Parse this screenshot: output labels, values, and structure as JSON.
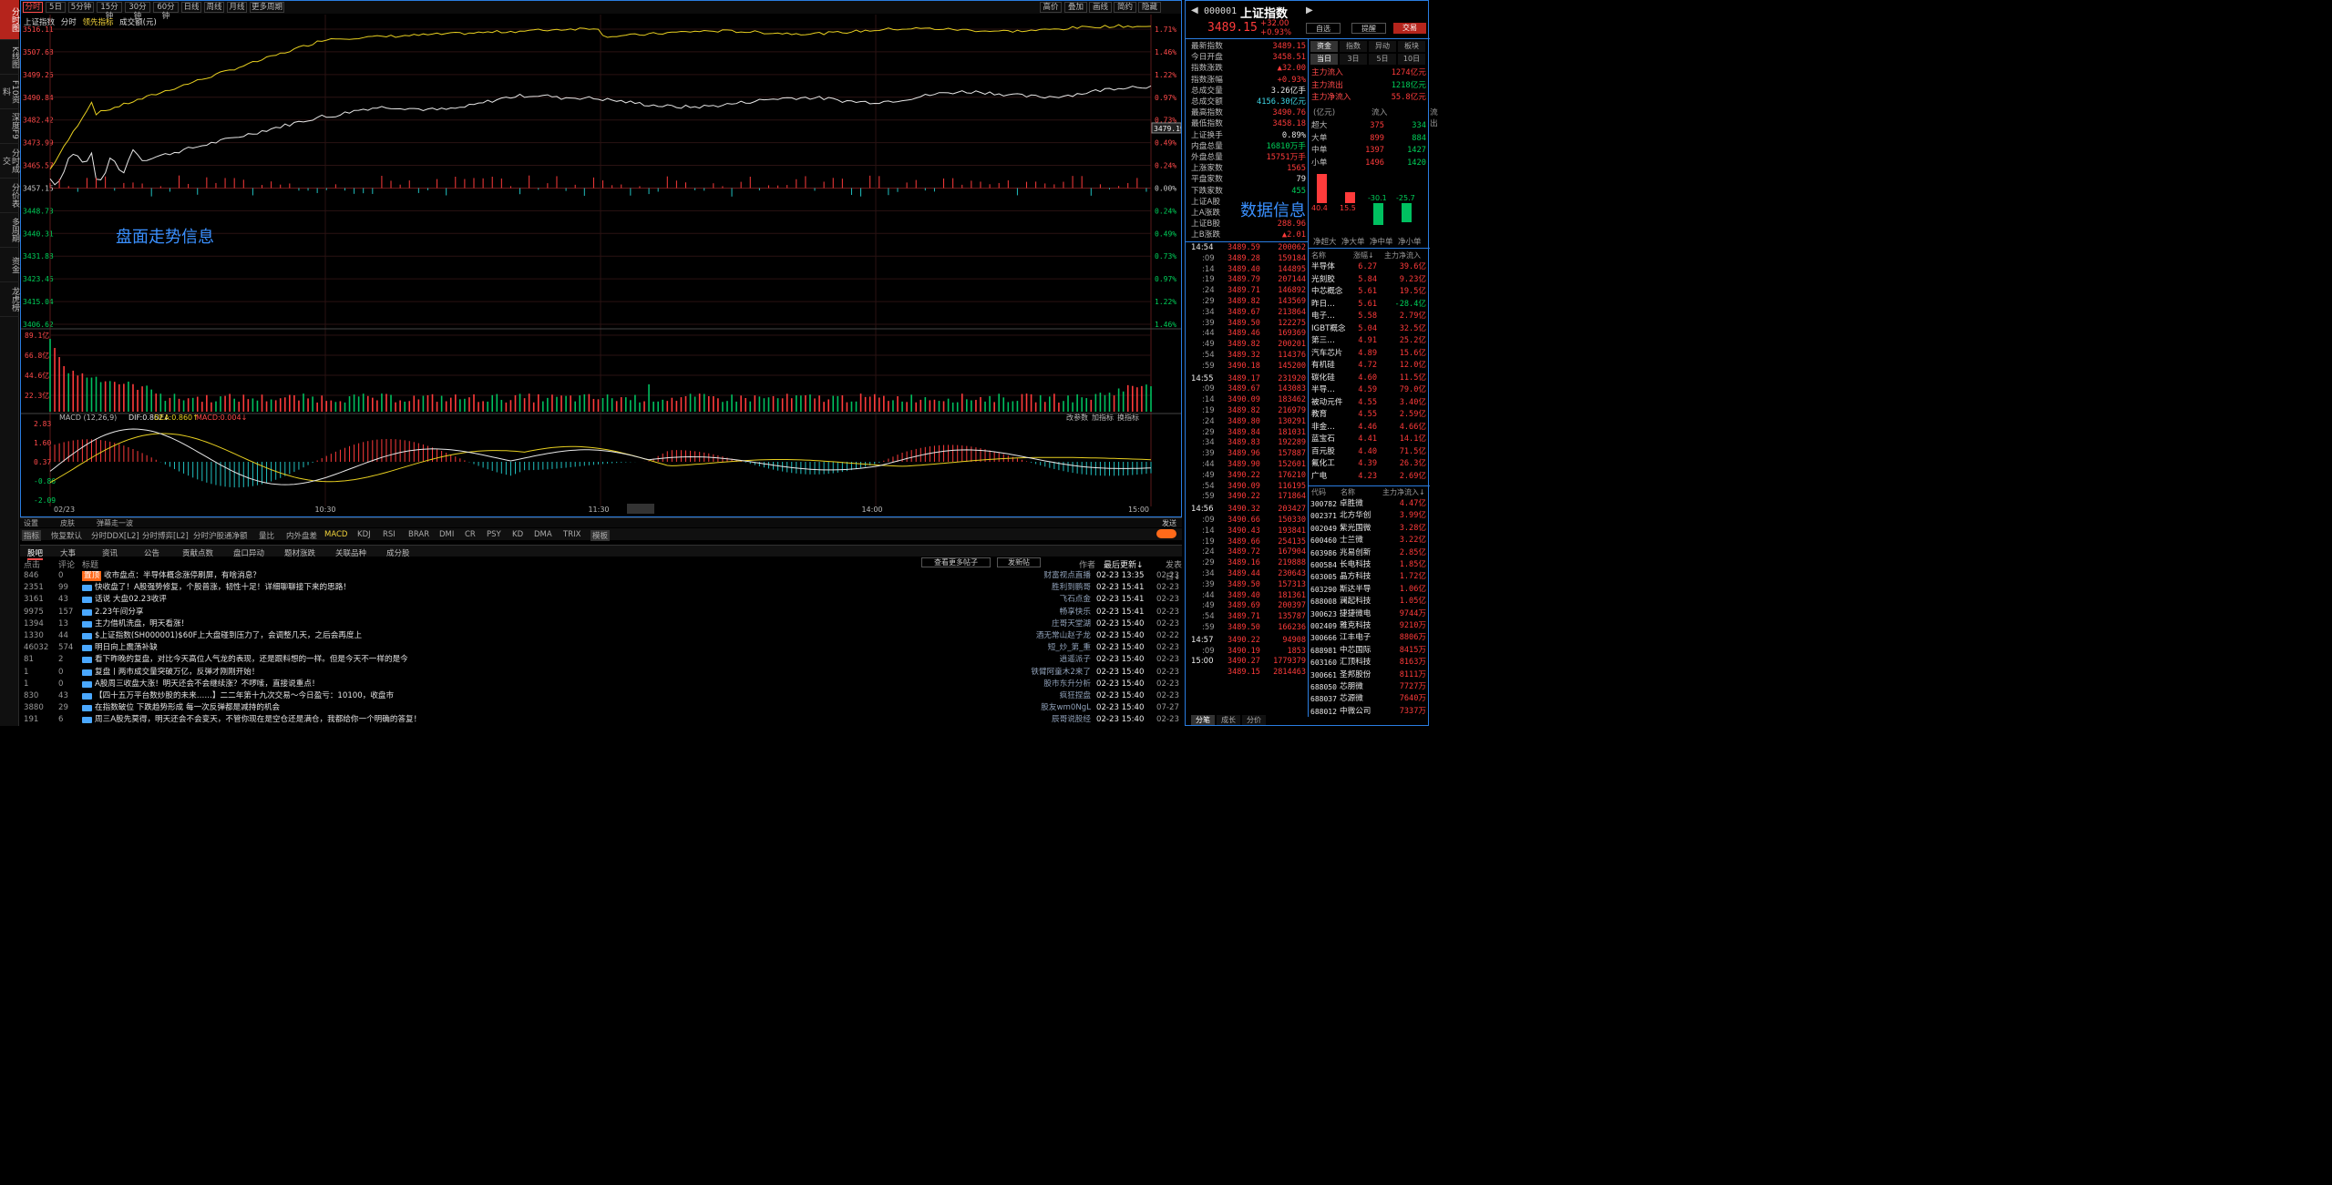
{
  "left_tabs": [
    "分时图",
    "K线图",
    "F10资料",
    "深度F9",
    "分时成交",
    "分价表",
    "多周期",
    "资金",
    "龙虎榜"
  ],
  "period": {
    "items": [
      "分时",
      "5日",
      "5分钟",
      "15分钟",
      "30分钟",
      "60分钟",
      "日线",
      "周线",
      "月线",
      "更多周期"
    ],
    "right": [
      "叠加",
      "画线",
      "简约",
      "隐藏"
    ],
    "gaodi": "高价"
  },
  "legend": {
    "name": "上证指数",
    "sub1": "分时",
    "sub2": "领先指标",
    "sub3": "成交额(元)"
  },
  "chart_labels": {
    "left": [
      "3516.11",
      "3507.68",
      "3499.26",
      "3490.84",
      "3482.42",
      "3473.99",
      "3465.57",
      "3457.15",
      "3448.73",
      "3440.31",
      "3431.88",
      "3423.46",
      "3415.04",
      "3406.62"
    ],
    "right": [
      "1.71%",
      "1.46%",
      "1.22%",
      "0.97%",
      "0.73%",
      "0.49%",
      "0.24%",
      "0.00%",
      "0.24%",
      "0.49%",
      "0.73%",
      "0.97%",
      "1.22%",
      "1.46%"
    ],
    "vol": [
      "89.1亿",
      "66.8亿",
      "44.6亿",
      "22.3亿"
    ],
    "macd": [
      "2.83",
      "1.60",
      "0.37",
      "-0.86",
      "-2.09"
    ],
    "time": [
      "02/23",
      "10:30",
      "11:30",
      "13:02",
      "14:00",
      "15:00"
    ],
    "cur": "3479.19",
    "annot": "盘面走势信息",
    "macd_title": "MACD (12,26,9)",
    "dif": "DIF:0.862↓",
    "dea": "DEA:0.860↑",
    "macdv": "MACD:0.004↓",
    "right_btns": [
      "改参数",
      "加指标",
      "换指标"
    ]
  },
  "bottom_tabs": [
    "设置",
    "皮肤",
    "弹幕走一波"
  ],
  "bottom_right": "发送",
  "ind_bar": [
    "指标",
    "恢复默认",
    "分时DDX[L2]",
    "分时博弈[L2]",
    "分时沪股通净额",
    "量比",
    "内外盘差",
    "MACD",
    "KDJ",
    "RSI",
    "BRAR",
    "DMI",
    "CR",
    "PSY",
    "KD",
    "DMA",
    "TRIX",
    "模板"
  ],
  "news_tabs": [
    "股吧",
    "大事",
    "资讯",
    "公告",
    "贡献点数",
    "盘口异动",
    "题材涨跌",
    "关联品种",
    "成分股"
  ],
  "news_head": {
    "c1": "点击",
    "c2": "评论",
    "c3": "标题",
    "btn1": "查看更多帖子",
    "btn2": "发新帖",
    "author": "作者",
    "latest": "最后更新↓",
    "post": "发表日↓"
  },
  "news": [
    {
      "clicks": "846",
      "comments": "0",
      "tag": "置顶",
      "title": "收市盘点：半导体概念涨停刷屏，有啥消息？",
      "author": "财富视点直播",
      "time": "02-23 13:35",
      "date": "02-23"
    },
    {
      "clicks": "2351",
      "comments": "99",
      "tag": "",
      "title": "快收盘了！A股强势修复，个股普涨，韧性十足！详细聊聊接下来的思路！",
      "author": "胜利到鹏哥",
      "time": "02-23 15:41",
      "date": "02-23"
    },
    {
      "clicks": "3161",
      "comments": "43",
      "tag": "",
      "title": "话说  大盘02.23收评",
      "author": "飞石点金",
      "time": "02-23 15:41",
      "date": "02-23"
    },
    {
      "clicks": "9975",
      "comments": "157",
      "tag": "",
      "title": "2.23午间分享",
      "author": "畅享快乐",
      "time": "02-23 15:41",
      "date": "02-23"
    },
    {
      "clicks": "1394",
      "comments": "13",
      "tag": "",
      "title": "主力借机洗盘，明天看涨！",
      "author": "庄哥天堂湖",
      "time": "02-23 15:40",
      "date": "02-23"
    },
    {
      "clicks": "1330",
      "comments": "44",
      "tag": "",
      "title": "$上证指数(SH000001)$60F上大盘碰到压力了，会调整几天，之后会再度上",
      "author": "酒无常山赵子龙",
      "time": "02-23 15:40",
      "date": "02-22"
    },
    {
      "clicks": "46032",
      "comments": "574",
      "tag": "",
      "title": "明日向上震荡补缺",
      "author": "短_炒_第_重",
      "time": "02-23 15:40",
      "date": "02-23"
    },
    {
      "clicks": "81",
      "comments": "2",
      "tag": "",
      "title": "看下昨晚的复盘，对比今天高位人气龙的表现，还是跟料想的一样。但是今天不一样的是今",
      "author": "逍遥派子",
      "time": "02-23 15:40",
      "date": "02-23"
    },
    {
      "clicks": "1",
      "comments": "0",
      "tag": "",
      "title": "复盘丨两市成交量突破万亿，反弹才刚刚开始！",
      "author": "铁臂阿童木2来了",
      "time": "02-23 15:40",
      "date": "02-23"
    },
    {
      "clicks": "1",
      "comments": "0",
      "tag": "",
      "title": "A股周三收盘大涨！明天还会不会继续涨？不啰嗦，直接说重点！",
      "author": "股市东升分析",
      "time": "02-23 15:40",
      "date": "02-23"
    },
    {
      "clicks": "830",
      "comments": "43",
      "tag": "",
      "title": "【四十五万平台数炒股的未来……】二二年第十九次交易～今日盈亏：10100，收盘市",
      "author": "疯狂捏盘",
      "time": "02-23 15:40",
      "date": "02-23"
    },
    {
      "clicks": "3880",
      "comments": "29",
      "tag": "",
      "title": "在指数破位 下跌趋势形成 每一次反弹都是减持的机会",
      "author": "股友wm0NgL",
      "time": "02-23 15:40",
      "date": "07-27"
    },
    {
      "clicks": "191",
      "comments": "6",
      "tag": "",
      "title": "周三A股先莫得，明天还会不会变天，不管你现在是空仓还是满仓，我都给你一个明确的答复！",
      "author": "辰哥说股经",
      "time": "02-23 15:40",
      "date": "02-23"
    }
  ],
  "rp": {
    "code": "000001",
    "name": "上证指数",
    "price": "3489.15",
    "chg": "+32.00",
    "pct": "+0.93%",
    "btn1": "自选",
    "btn2": "提醒",
    "btn3": "交易",
    "kv": [
      [
        "最新指数",
        "3489.15",
        "red"
      ],
      [
        "今日开盘",
        "3458.51",
        "red"
      ],
      [
        "指数涨跌",
        "▲32.00",
        "red"
      ],
      [
        "指数涨幅",
        "+0.93%",
        "red"
      ],
      [
        "总成交量",
        "3.26亿手",
        "white"
      ],
      [
        "总成交额",
        "4156.30亿元",
        "cyan"
      ],
      [
        "最高指数",
        "3490.76",
        "red"
      ],
      [
        "最低指数",
        "3458.18",
        "red"
      ],
      [
        "上证换手",
        "0.89%",
        "white"
      ],
      [
        "内盘总量",
        "16810万手",
        "green"
      ],
      [
        "外盘总量",
        "15751万手",
        "red"
      ],
      [
        "上涨家数",
        "1565",
        "red"
      ],
      [
        "平盘家数",
        "79",
        "white"
      ],
      [
        "下跌家数",
        "455",
        "green"
      ],
      [
        "上证A股",
        "",
        ""
      ],
      [
        "上A涨跌",
        "",
        ""
      ],
      [
        "上证B股",
        "288.96",
        "red"
      ],
      [
        "上B涨跌",
        "▲2.01",
        "red"
      ]
    ],
    "annot": "数据信息",
    "ftabs": [
      "资金",
      "指数",
      "异动",
      "板块"
    ],
    "ptabs": [
      "当日",
      "3日",
      "5日",
      "10日"
    ],
    "flow": [
      [
        "主力流入",
        "1274亿元",
        "red"
      ],
      [
        "主力流出",
        "1218亿元",
        "green"
      ],
      [
        "主力净流入",
        "55.8亿元",
        "red"
      ]
    ],
    "flowhead": [
      "(亿元)",
      "流入",
      "流出"
    ],
    "flowrows": [
      [
        "超大",
        "375",
        "334"
      ],
      [
        "大单",
        "899",
        "884"
      ],
      [
        "中单",
        "1397",
        "1427"
      ],
      [
        "小单",
        "1496",
        "1420"
      ]
    ],
    "bars": [
      {
        "label": "40.4",
        "v": 40.4
      },
      {
        "label": "15.5",
        "v": 15.5
      },
      {
        "label": "-30.1",
        "v": -30.1
      },
      {
        "label": "-25.7",
        "v": -25.7
      }
    ],
    "barnames": [
      "净超大",
      "净大单",
      "净中单",
      "净小单"
    ],
    "ticks": [
      [
        "14:54",
        "3489.59",
        "200062",
        "r"
      ],
      [
        ":09",
        "3489.28",
        "159184",
        "r"
      ],
      [
        ":14",
        "3489.40",
        "144895",
        "r"
      ],
      [
        ":19",
        "3489.79",
        "207144",
        "r"
      ],
      [
        ":24",
        "3489.71",
        "146892",
        "r"
      ],
      [
        ":29",
        "3489.82",
        "143569",
        "r"
      ],
      [
        ":34",
        "3489.67",
        "213864",
        "r"
      ],
      [
        ":39",
        "3489.50",
        "122275",
        "r"
      ],
      [
        ":44",
        "3489.46",
        "169369",
        "r"
      ],
      [
        ":49",
        "3489.82",
        "200201",
        "r"
      ],
      [
        ":54",
        "3489.32",
        "114376",
        "r"
      ],
      [
        ":59",
        "3490.18",
        "145200",
        "r"
      ],
      [
        "14:55",
        "3489.17",
        "231920",
        "r"
      ],
      [
        ":09",
        "3489.67",
        "143083",
        "r"
      ],
      [
        ":14",
        "3490.09",
        "183462",
        "r"
      ],
      [
        ":19",
        "3489.82",
        "216979",
        "r"
      ],
      [
        ":24",
        "3489.80",
        "130291",
        "r"
      ],
      [
        ":29",
        "3489.84",
        "181031",
        "r"
      ],
      [
        ":34",
        "3489.83",
        "192289",
        "r"
      ],
      [
        ":39",
        "3489.96",
        "157887",
        "r"
      ],
      [
        ":44",
        "3489.90",
        "152601",
        "r"
      ],
      [
        ":49",
        "3490.22",
        "176210",
        "r"
      ],
      [
        ":54",
        "3490.09",
        "116195",
        "r"
      ],
      [
        ":59",
        "3490.22",
        "171864",
        "r"
      ],
      [
        "14:56",
        "3490.32",
        "203427",
        "r"
      ],
      [
        ":09",
        "3490.66",
        "150330",
        "r"
      ],
      [
        ":14",
        "3490.43",
        "193841",
        "r"
      ],
      [
        ":19",
        "3489.66",
        "254135",
        "r"
      ],
      [
        ":24",
        "3489.72",
        "167904",
        "r"
      ],
      [
        ":29",
        "3489.16",
        "219888",
        "r"
      ],
      [
        ":34",
        "3489.44",
        "230643",
        "r"
      ],
      [
        ":39",
        "3489.50",
        "157313",
        "r"
      ],
      [
        ":44",
        "3489.40",
        "181361",
        "r"
      ],
      [
        ":49",
        "3489.69",
        "200397",
        "r"
      ],
      [
        ":54",
        "3489.71",
        "135787",
        "r"
      ],
      [
        ":59",
        "3489.50",
        "166236",
        "r"
      ],
      [
        "14:57",
        "3490.22",
        "94908",
        "r"
      ],
      [
        ":09",
        "3490.19",
        "1853",
        "r"
      ],
      [
        "15:00",
        "3490.27",
        "1779379",
        "r"
      ],
      [
        "",
        "3489.15",
        "2814463",
        "r"
      ]
    ],
    "sec_head": [
      "名称",
      "涨幅↓",
      "主力净流入"
    ],
    "sectors": [
      [
        "半导体",
        "6.27",
        "39.6亿"
      ],
      [
        "光刻胶",
        "5.84",
        "9.23亿"
      ],
      [
        "中芯概念",
        "5.61",
        "19.5亿"
      ],
      [
        "昨日…",
        "5.61",
        "-28.4亿"
      ],
      [
        "电子…",
        "5.58",
        "2.79亿"
      ],
      [
        "IGBT概念",
        "5.04",
        "32.5亿"
      ],
      [
        "第三…",
        "4.91",
        "25.2亿"
      ],
      [
        "汽车芯片",
        "4.89",
        "15.6亿"
      ],
      [
        "有机硅",
        "4.72",
        "12.0亿"
      ],
      [
        "碳化硅",
        "4.60",
        "11.5亿"
      ],
      [
        "半导…",
        "4.59",
        "79.0亿"
      ],
      [
        "被动元件",
        "4.55",
        "3.40亿"
      ],
      [
        "教育",
        "4.55",
        "2.59亿"
      ],
      [
        "非金…",
        "4.46",
        "4.66亿"
      ],
      [
        "蓝宝石",
        "4.41",
        "14.1亿"
      ],
      [
        "百元股",
        "4.40",
        "71.5亿"
      ],
      [
        "氟化工",
        "4.39",
        "26.3亿"
      ],
      [
        "广电",
        "4.23",
        "2.69亿"
      ]
    ],
    "stk_head": [
      "代码",
      "名称",
      "主力净流入↓"
    ],
    "stocks": [
      [
        "300782",
        "卓胜微",
        "4.47亿"
      ],
      [
        "002371",
        "北方华创",
        "3.99亿"
      ],
      [
        "002049",
        "紫光国微",
        "3.28亿"
      ],
      [
        "600460",
        "士兰微",
        "3.22亿"
      ],
      [
        "603986",
        "兆易创新",
        "2.85亿"
      ],
      [
        "600584",
        "长电科技",
        "1.85亿"
      ],
      [
        "603005",
        "晶方科技",
        "1.72亿"
      ],
      [
        "603290",
        "斯达半导",
        "1.06亿"
      ],
      [
        "688008",
        "澜起科技",
        "1.05亿"
      ],
      [
        "300623",
        "捷捷微电",
        "9744万"
      ],
      [
        "002409",
        "雅克科技",
        "9210万"
      ],
      [
        "300666",
        "江丰电子",
        "8806万"
      ],
      [
        "688981",
        "中芯国际",
        "8415万"
      ],
      [
        "603160",
        "汇顶科技",
        "8163万"
      ],
      [
        "300661",
        "圣邦股份",
        "8111万"
      ],
      [
        "688050",
        "芯朋微",
        "7727万"
      ],
      [
        "688037",
        "芯源微",
        "7640万"
      ],
      [
        "688012",
        "中微公司",
        "7337万"
      ]
    ],
    "foot": [
      "分笔",
      "成长",
      "分价"
    ]
  }
}
